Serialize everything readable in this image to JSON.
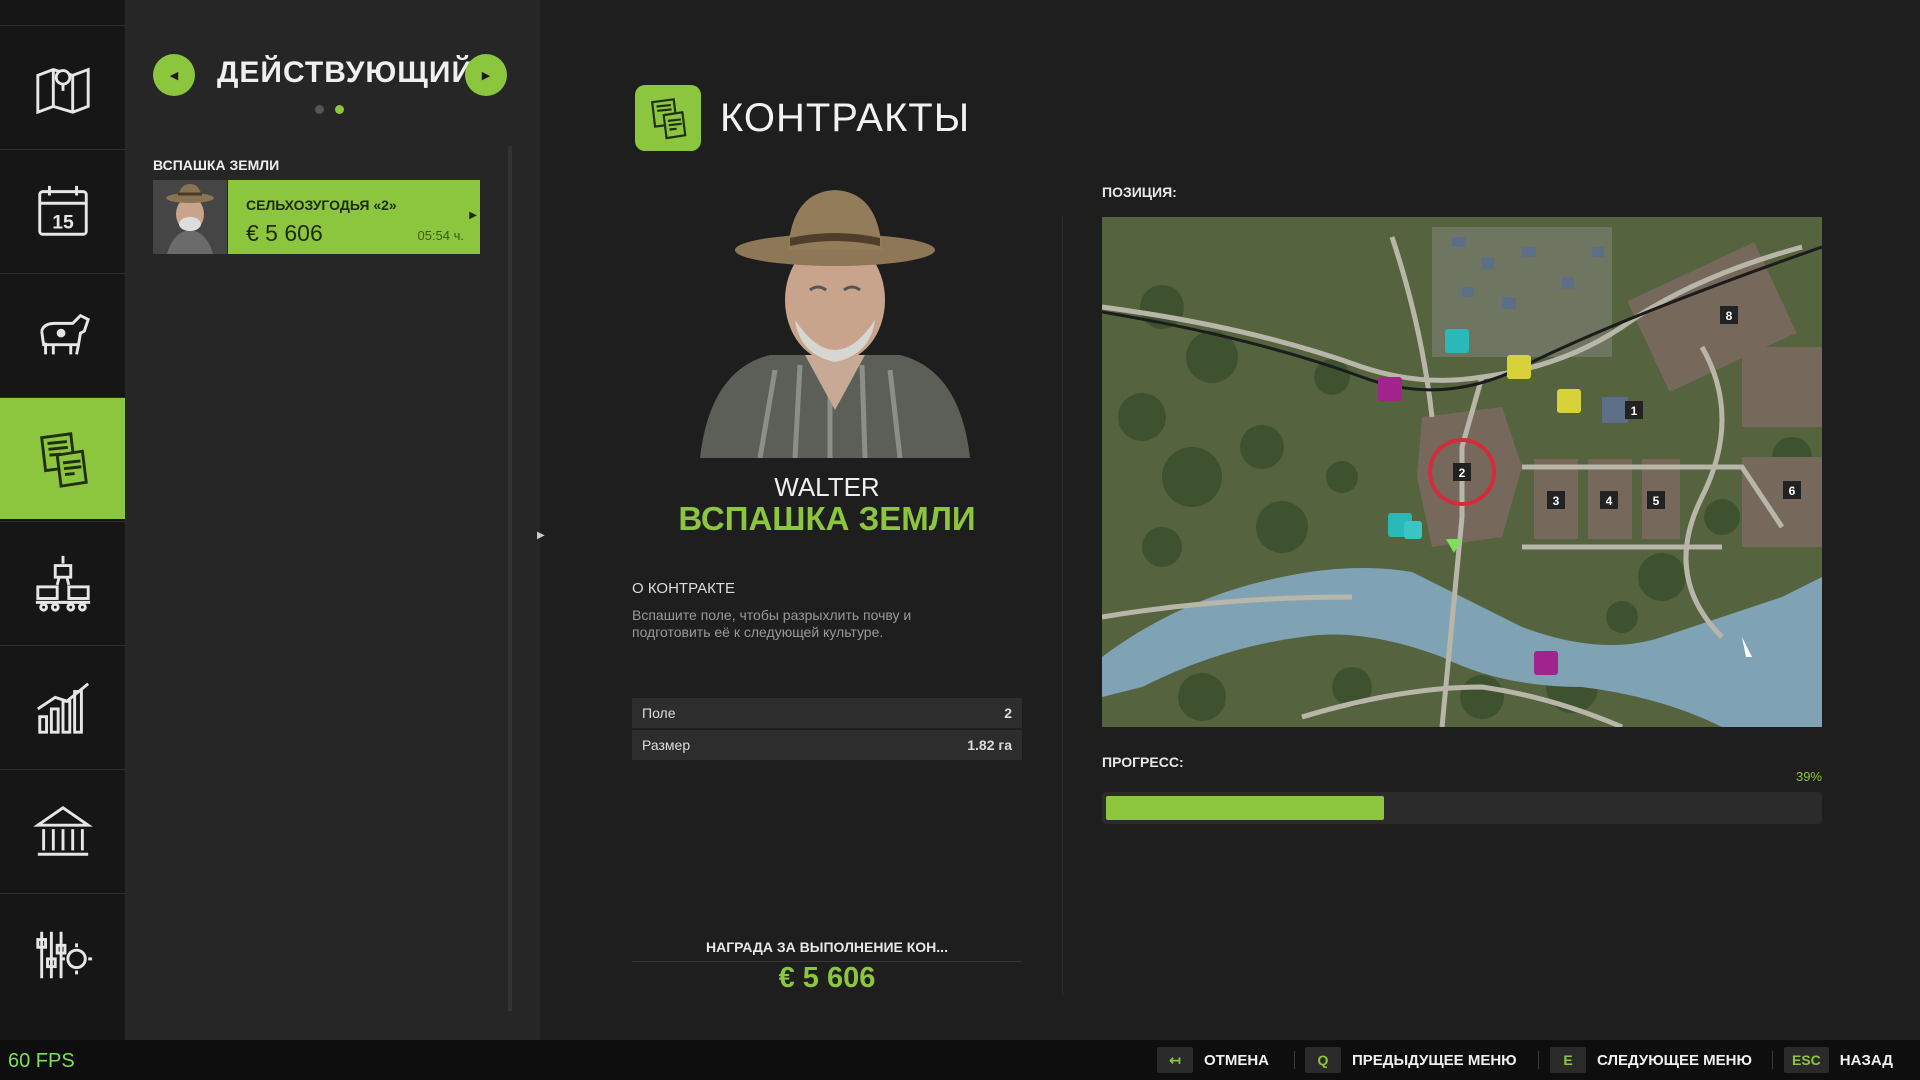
{
  "sidebar": {
    "items": [
      {
        "id": "map",
        "icon": "map-icon"
      },
      {
        "id": "calendar",
        "icon": "calendar-icon",
        "text": "15"
      },
      {
        "id": "animals",
        "icon": "cow-icon"
      },
      {
        "id": "contracts",
        "icon": "contracts-icon",
        "active": true
      },
      {
        "id": "production",
        "icon": "production-icon"
      },
      {
        "id": "prices",
        "icon": "chart-icon"
      },
      {
        "id": "finances",
        "icon": "bank-icon"
      },
      {
        "id": "settings",
        "icon": "settings-icon"
      }
    ]
  },
  "list": {
    "filter_title": "ДЕЙСТВУЮЩИЙ",
    "group_label": "ВСПАШКА ЗЕМЛИ",
    "job": {
      "farm": "СЕЛЬХОЗУГОДЬЯ «2»",
      "reward": "€ 5 606",
      "time": "05:54 ч."
    }
  },
  "details": {
    "section_title": "КОНТРАКТЫ",
    "npc_name": "WALTER",
    "contract_name": "ВСПАШКА ЗЕМЛИ",
    "about_label": "О КОНТРАКТЕ",
    "about_text": "Вспашите поле, чтобы разрыхлить почву и подготовить её к следующей культуре.",
    "info": [
      {
        "key": "Поле",
        "value": "2"
      },
      {
        "key": "Размер",
        "value": "1.82 га"
      }
    ],
    "reward_label": "НАГРАДА ЗА ВЫПОЛНЕНИЕ КОН...",
    "reward_value": "€ 5 606",
    "position_label": "ПОЗИЦИЯ:",
    "progress_label": "ПРОГРЕСС:",
    "progress_pct_text": "39%",
    "progress_fraction": 0.39,
    "map_fields": [
      "1",
      "2",
      "3",
      "4",
      "5",
      "6",
      "8"
    ]
  },
  "colors": {
    "accent": "#8cc63f",
    "background": "#1e1e1e",
    "panel": "#262626",
    "water": "#7fa3b4",
    "grass": "#55633f"
  },
  "footer": {
    "fps": "60 FPS",
    "hints": [
      {
        "key": "↤",
        "label": "ОТМЕНА"
      },
      {
        "key": "Q",
        "label": "ПРЕДЫДУЩЕЕ МЕНЮ"
      },
      {
        "key": "E",
        "label": "СЛЕДУЮЩЕЕ МЕНЮ"
      },
      {
        "key": "ESC",
        "label": "НАЗАД"
      }
    ]
  }
}
